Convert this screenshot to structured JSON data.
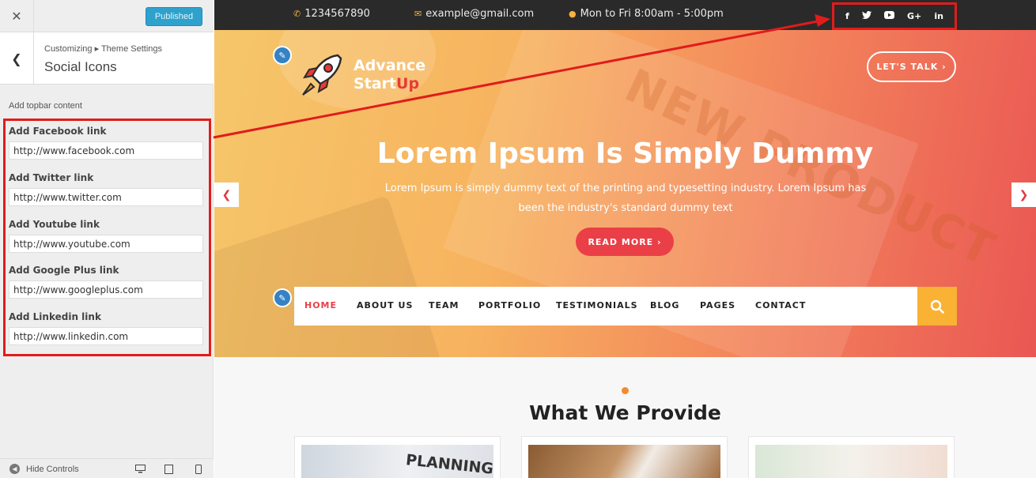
{
  "customizer": {
    "close_icon": "close-icon",
    "publish_label": "Published",
    "breadcrumb": "Customizing ▸ Theme Settings",
    "section_title": "Social Icons",
    "topbar_note": "Add topbar content",
    "fields": [
      {
        "label": "Add Facebook link",
        "value": "http://www.facebook.com"
      },
      {
        "label": "Add Twitter link",
        "value": "http://www.twitter.com"
      },
      {
        "label": "Add Youtube link",
        "value": "http://www.youtube.com"
      },
      {
        "label": "Add Google Plus link",
        "value": "http://www.googleplus.com"
      },
      {
        "label": "Add Linkedin link",
        "value": "http://www.linkedin.com"
      }
    ],
    "hide_controls": "Hide Controls"
  },
  "topbar": {
    "phone": "1234567890",
    "email": "example@gmail.com",
    "hours": "Mon to Fri 8:00am - 5:00pm",
    "social": [
      "f",
      "t",
      "yt",
      "G+",
      "in"
    ]
  },
  "hero": {
    "logo_line1": "Advance",
    "logo_line2a": "Start",
    "logo_line2b": "Up",
    "talk_label": "LET'S TALK ›",
    "title": "Lorem Ipsum Is Simply Dummy",
    "subtitle": "Lorem Ipsum is simply dummy text of the printing and typesetting industry. Lorem Ipsum has been the industry's standard dummy text",
    "read_more": "READ MORE  ›",
    "watermark": "NEW PRODUCT"
  },
  "nav": {
    "items": [
      "HOME",
      "ABOUT US",
      "TEAM",
      "PORTFOLIO",
      "TESTIMONIALS",
      "BLOG",
      "PAGES",
      "CONTACT"
    ],
    "active": "HOME"
  },
  "provide": {
    "title": "What We Provide",
    "card1_text": "PLANNING"
  },
  "colors": {
    "annotation": "#e01c1c",
    "accent_red": "#ea3f47",
    "accent_yellow": "#f9b233",
    "publish_blue": "#2ea2cc"
  }
}
